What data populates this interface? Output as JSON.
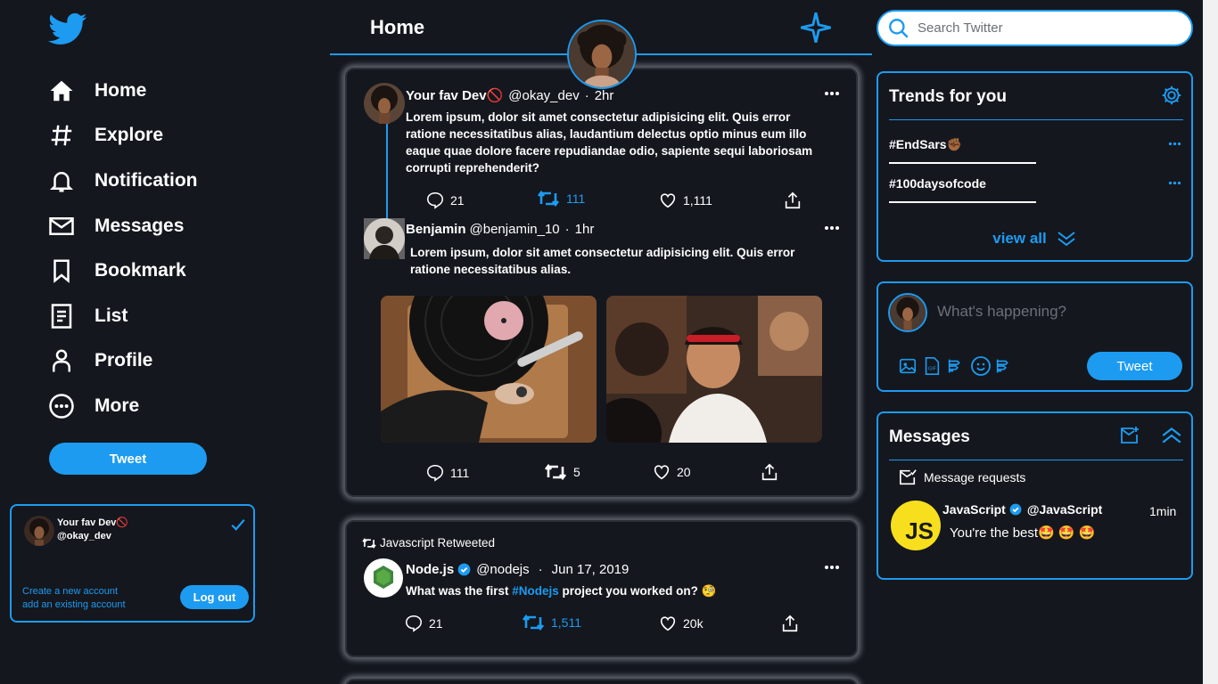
{
  "colors": {
    "accent": "#1d9bf0",
    "background": "#14171e",
    "text": "#ffffff"
  },
  "nav": {
    "items": [
      {
        "label": "Home",
        "icon": "home-icon"
      },
      {
        "label": "Explore",
        "icon": "hashtag-icon"
      },
      {
        "label": "Notification",
        "icon": "bell-icon"
      },
      {
        "label": "Messages",
        "icon": "envelope-icon"
      },
      {
        "label": "Bookmark",
        "icon": "bookmark-icon"
      },
      {
        "label": "List",
        "icon": "list-icon"
      },
      {
        "label": "Profile",
        "icon": "person-icon"
      },
      {
        "label": "More",
        "icon": "more-circle-icon"
      }
    ],
    "tweet_button": "Tweet"
  },
  "account": {
    "name": "Your fav Dev🚫",
    "handle": "@okay_dev",
    "create_link": "Create a new account",
    "add_link": "add an existing account",
    "logout": "Log out"
  },
  "header": {
    "title": "Home"
  },
  "tweets": [
    {
      "name": "Your fav Dev🚫",
      "handle": "@okay_dev",
      "separator": "·",
      "time": "2hr",
      "text": "Lorem ipsum, dolor sit amet consectetur adipisicing elit. Quis error ratione necessitatibus alias, laudantium delectus optio minus eum illo eaque quae dolore facere repudiandae odio, sapiente sequi laboriosam corrupti reprehenderit?",
      "replies": "21",
      "retweets": "111",
      "likes": "1,111"
    },
    {
      "name": "Benjamin",
      "handle": "@benjamin_10",
      "separator": "·",
      "time": "1hr",
      "text": "Lorem ipsum, dolor sit amet consectetur adipisicing elit. Quis error ratione necessitatibus alias.",
      "replies": "111",
      "retweets": "5",
      "likes": "20"
    },
    {
      "retweeted_by": "Javascript Retweeted",
      "name": "Node.js",
      "handle": "@nodejs",
      "separator": "·",
      "time": "Jun 17, 2019",
      "text_before": "What was the first ",
      "hashtag": "#Nodejs",
      "text_after": " project you worked on? 🧐",
      "replies": "21",
      "retweets": "1,511",
      "likes": "20k"
    }
  ],
  "search": {
    "placeholder": "Search Twitter"
  },
  "trends": {
    "title": "Trends for you",
    "items": [
      "#EndSars✊🏾",
      "#100daysofcode"
    ],
    "view_all": "view all"
  },
  "compose": {
    "placeholder": "What's happening?",
    "button": "Tweet"
  },
  "messages": {
    "title": "Messages",
    "requests": "Message requests",
    "conversation": {
      "name": "JavaScript",
      "handle": "@JavaScript",
      "time": "1min",
      "preview": "You're the best🤩 🤩 🤩",
      "avatar_text": "JS"
    }
  }
}
